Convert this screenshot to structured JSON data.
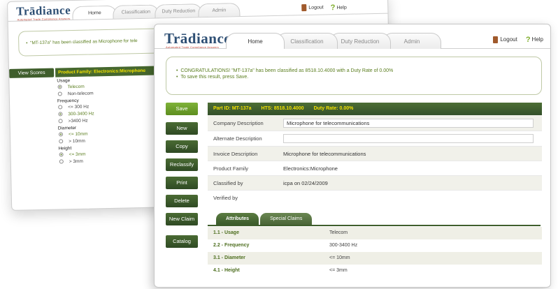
{
  "back_window": {
    "logo": "Trādiance",
    "logo_tagline": "Automated Trade Compliance Answers",
    "tabs": [
      "Home",
      "Classification",
      "Duty Reduction",
      "Admin"
    ],
    "logout": "Logout",
    "help": "Help",
    "message": "\"MT-137a\" has been classified as Microphone for tele",
    "view_scores": "View Scores",
    "product_family": "Product Family: Electronics:Microphone",
    "filters": [
      {
        "group": "Usage",
        "options": [
          {
            "label": "Telecom",
            "selected": true
          },
          {
            "label": "Non-telecom",
            "selected": false
          }
        ]
      },
      {
        "group": "Frequency",
        "options": [
          {
            "label": "<= 300 Hz",
            "selected": false
          },
          {
            "label": "300-3400 Hz",
            "selected": true
          },
          {
            "label": ">3400 Hz",
            "selected": false
          }
        ]
      },
      {
        "group": "Diameter",
        "options": [
          {
            "label": "<= 10mm",
            "selected": true
          },
          {
            "label": "> 10mm",
            "selected": false
          }
        ]
      },
      {
        "group": "Height",
        "options": [
          {
            "label": "<= 3mm",
            "selected": true
          },
          {
            "label": "> 3mm",
            "selected": false
          }
        ]
      }
    ]
  },
  "front_window": {
    "logo": "Trādiance",
    "logo_tagline": "Automated Trade Compliance Answers",
    "tabs": [
      "Home",
      "Classification",
      "Duty Reduction",
      "Admin"
    ],
    "logout": "Logout",
    "help": "Help",
    "message_line1": "CONGRATULATIONS! \"MT-137a\" has been classified as 8518.10.4000 with a Duty Rate of 0.00%",
    "message_line2": "To save this result, press Save.",
    "side_buttons": [
      "Save",
      "New",
      "Copy",
      "Reclassify",
      "Print",
      "Delete",
      "New Claim",
      "Catalog"
    ],
    "header": {
      "part_id": "Part ID: MT-137a",
      "hts": "HTS: 8518.10.4000",
      "duty_rate": "Duty Rate: 0.00%"
    },
    "fields": [
      {
        "label": "Company Description",
        "value": "Microphone for telecommunications"
      },
      {
        "label": "Alternate Description",
        "value": ""
      },
      {
        "label": "Invoice Description",
        "value": "Microphone for telecommunications"
      },
      {
        "label": "Product Family",
        "value": "Electronics:Microphone"
      },
      {
        "label": "Classified by",
        "value": "icpa on 02/24/2009"
      },
      {
        "label": "Verified by",
        "value": ""
      }
    ],
    "subtabs": [
      "Attributes",
      "Special Claims"
    ],
    "attributes": [
      {
        "name": "1.1 - Usage",
        "value": "Telecom"
      },
      {
        "name": "2.2 - Frequency",
        "value": "300-3400 Hz"
      },
      {
        "name": "3.1 - Diameter",
        "value": "<= 10mm"
      },
      {
        "name": "4.1 - Height",
        "value": "<= 3mm"
      }
    ]
  },
  "colors": {
    "dark_green": "#3f5e2c",
    "bright_green": "#7fb239",
    "highlight_yellow": "#f4e200",
    "logo_blue": "#2e4f74"
  }
}
